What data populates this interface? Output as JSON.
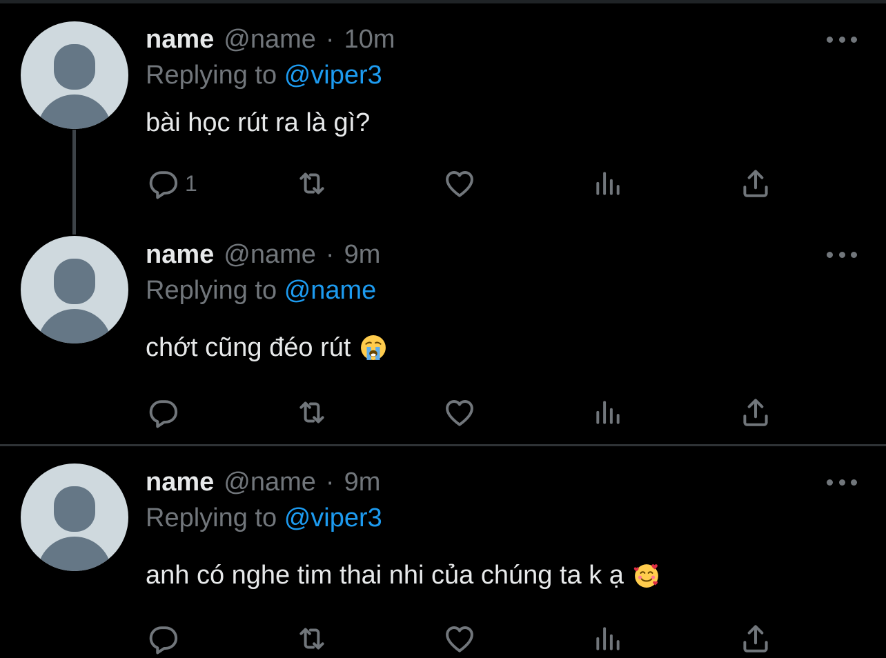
{
  "colors": {
    "background": "#000000",
    "text": "#e7e9ea",
    "muted": "#71767b",
    "link": "#1d9bf0",
    "avatar_bg": "#cfd9de",
    "avatar_fg": "#657786"
  },
  "icons": {
    "reply": "reply-icon",
    "retweet": "retweet-icon",
    "like": "heart-icon",
    "views": "analytics-icon",
    "share": "share-icon",
    "more": "more-icon"
  },
  "tweets": [
    {
      "display_name": "name",
      "handle": "@name",
      "separator": "·",
      "time": "10m",
      "replying_prefix": "Replying to",
      "replying_to": "@viper3",
      "text": "bài học rút ra là gì?",
      "emoji": "",
      "reply_count": "1"
    },
    {
      "display_name": "name",
      "handle": "@name",
      "separator": "·",
      "time": "9m",
      "replying_prefix": "Replying to",
      "replying_to": "@name",
      "text": "chớt cũng đéo rút",
      "emoji": "crying-face-emoji",
      "reply_count": ""
    },
    {
      "display_name": "name",
      "handle": "@name",
      "separator": "·",
      "time": "9m",
      "replying_prefix": "Replying to",
      "replying_to": "@viper3",
      "text": "anh có nghe tim thai nhi của chúng ta k ạ",
      "emoji": "smiling-face-with-hearts-emoji",
      "reply_count": ""
    }
  ]
}
